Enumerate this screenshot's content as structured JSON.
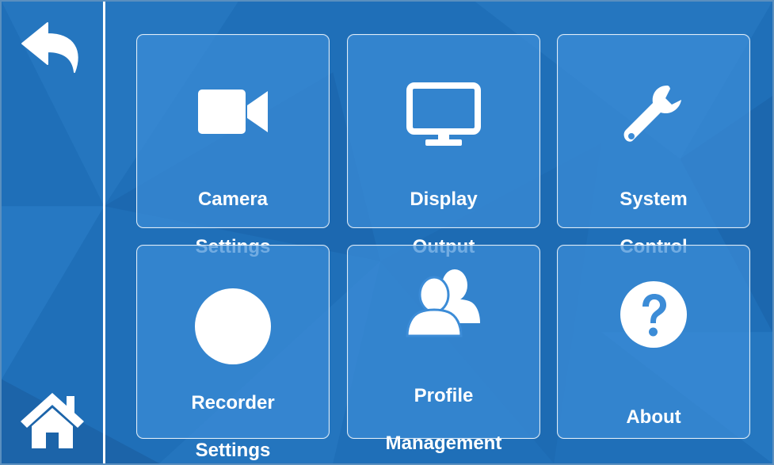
{
  "nav": {
    "back_icon": "back-arrow-icon",
    "home_icon": "home-icon"
  },
  "tiles": [
    {
      "line1": "Camera",
      "line2": "Settings",
      "icon": "video-camera-icon"
    },
    {
      "line1": "Display",
      "line2": "Output",
      "icon": "monitor-icon"
    },
    {
      "line1": "System",
      "line2": "Control",
      "icon": "wrench-icon"
    },
    {
      "line1": "Recorder",
      "line2": "Settings",
      "icon": "record-circle-icon"
    },
    {
      "line1": "Profile",
      "line2": "Management",
      "icon": "users-icon"
    },
    {
      "line1": "About",
      "line2": "",
      "icon": "question-circle-icon"
    }
  ],
  "colors": {
    "background": "#1f6fb8",
    "tile": "#3c8cd7",
    "foreground": "#ffffff"
  }
}
